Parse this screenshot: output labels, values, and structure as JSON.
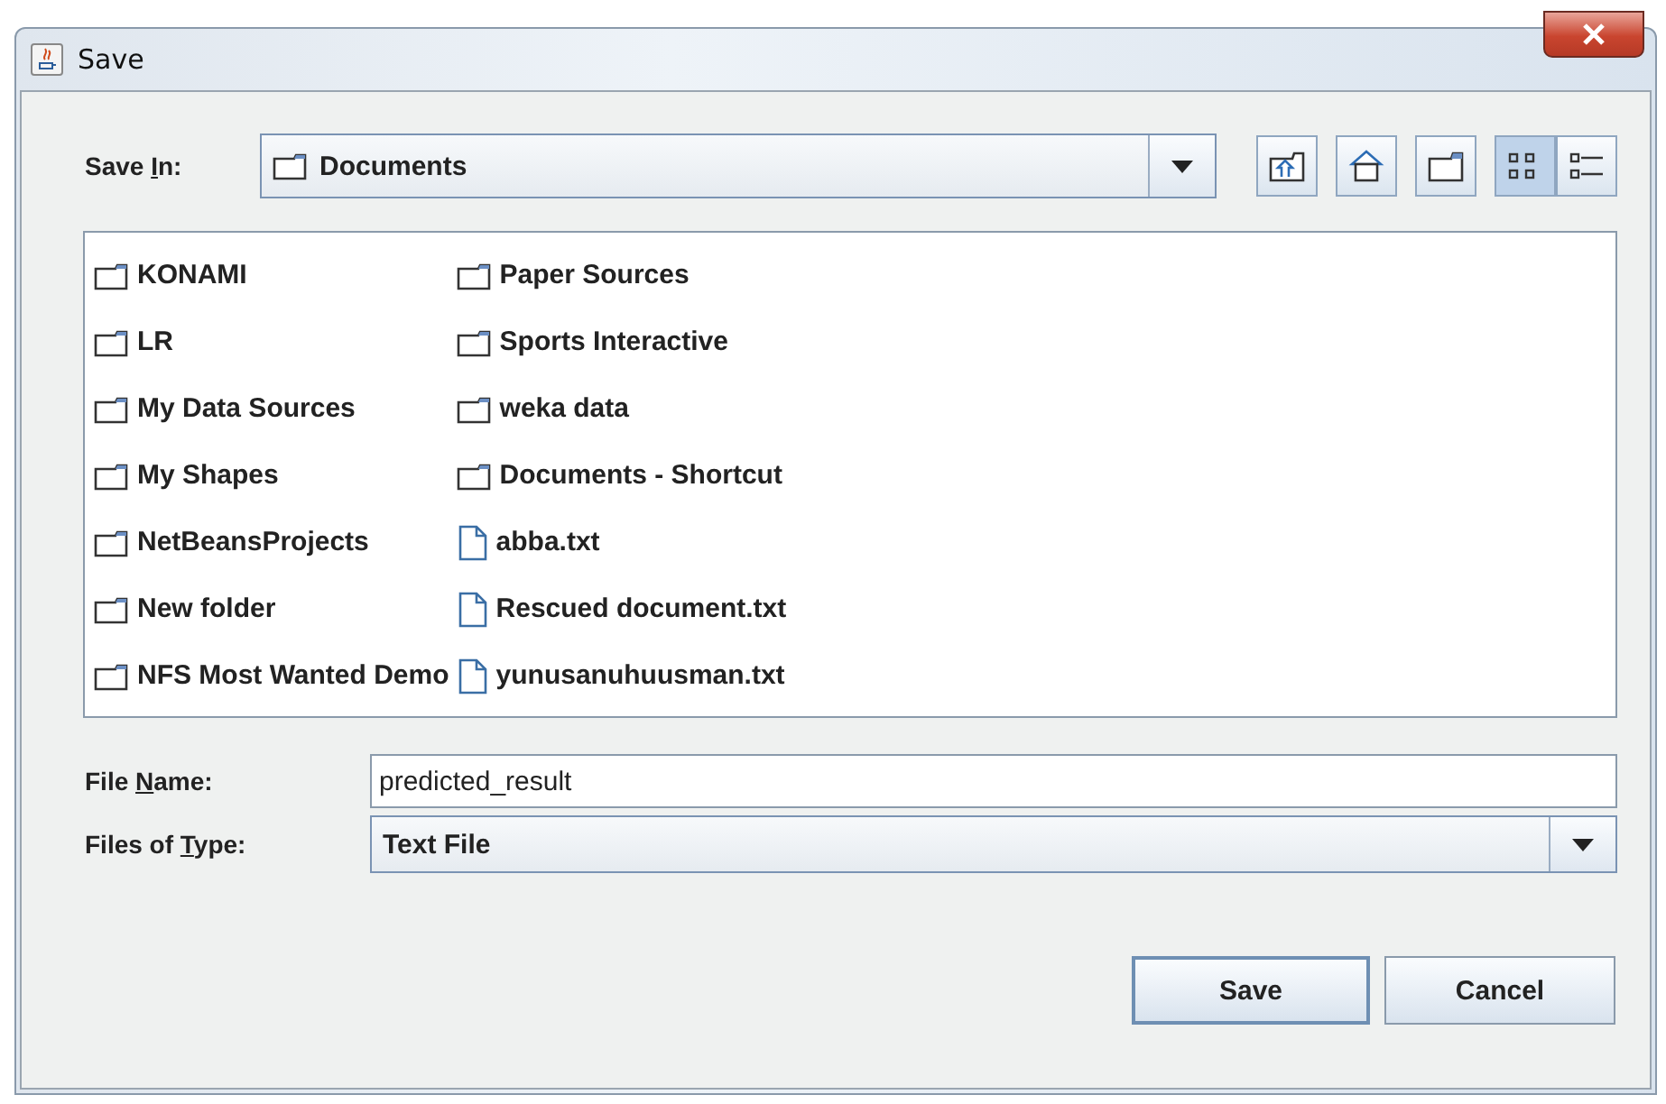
{
  "window": {
    "title": "Save"
  },
  "save_in": {
    "label_parts": [
      "Save ",
      "I",
      "n:"
    ],
    "value": "Documents"
  },
  "toolbar": [
    {
      "kind": "up",
      "selected": false
    },
    {
      "kind": "home",
      "selected": false
    },
    {
      "kind": "new-folder",
      "selected": false
    },
    {
      "kind": "list",
      "selected": true
    },
    {
      "kind": "details",
      "selected": false
    }
  ],
  "files": [
    {
      "name": "KONAMI",
      "kind": "folder"
    },
    {
      "name": "LR",
      "kind": "folder"
    },
    {
      "name": "My Data Sources",
      "kind": "folder"
    },
    {
      "name": "My Shapes",
      "kind": "folder"
    },
    {
      "name": "NetBeansProjects",
      "kind": "folder"
    },
    {
      "name": "New folder",
      "kind": "folder"
    },
    {
      "name": "NFS Most Wanted Demo",
      "kind": "folder"
    },
    {
      "name": "Paper Sources",
      "kind": "folder"
    },
    {
      "name": "Sports Interactive",
      "kind": "folder"
    },
    {
      "name": "weka data",
      "kind": "folder"
    },
    {
      "name": "Documents - Shortcut",
      "kind": "folder"
    },
    {
      "name": "abba.txt",
      "kind": "file"
    },
    {
      "name": "Rescued document.txt",
      "kind": "file"
    },
    {
      "name": "yunusanuhuusman.txt",
      "kind": "file"
    }
  ],
  "file_name": {
    "label_parts": [
      "File ",
      "N",
      "ame:"
    ],
    "value": "predicted_result"
  },
  "file_type": {
    "label_parts": [
      "Files of ",
      "T",
      "ype:"
    ],
    "value": "Text File"
  },
  "buttons": [
    {
      "label": "Save",
      "selected": true
    },
    {
      "label": "Cancel",
      "selected": false
    }
  ]
}
